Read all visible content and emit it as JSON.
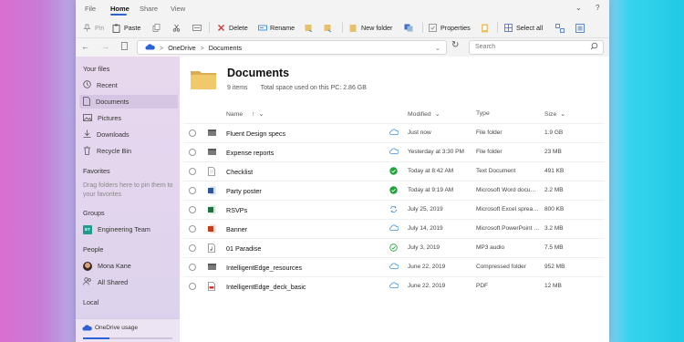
{
  "tabs": [
    "File",
    "Home",
    "Share",
    "View"
  ],
  "commands": {
    "pin": "Pin",
    "paste": "Paste",
    "delete": "Delete",
    "rename": "Rename",
    "new_folder": "New folder",
    "properties": "Properties",
    "select_all": "Select all"
  },
  "address": {
    "root": "OneDrive",
    "folder": "Documents",
    "search_placeholder": "Search"
  },
  "sidebar": {
    "your_files": "Your files",
    "items": [
      "Recent",
      "Documents",
      "Pictures",
      "Downloads",
      "Recycle Bin"
    ],
    "favorites": "Favorites",
    "favorites_note": "Drag folders here to pin them to your favorites",
    "groups": "Groups",
    "group_badge": "ET",
    "group_item": "Engineering Team",
    "people": "People",
    "people_items": [
      "Mona Kane",
      "All Shared"
    ],
    "local": "Local",
    "onedrive_usage": "OneDrive usage",
    "usage_fraction": 0.3
  },
  "content": {
    "title": "Documents",
    "item_count": "9 items",
    "space_used": "Total space used on this PC: 2.86 GB",
    "columns": {
      "name": "Name",
      "modified": "Modified",
      "type": "Type",
      "size": "Size"
    },
    "files": [
      {
        "name": "Fluent Design specs",
        "status": "cloud",
        "modified": "Just now",
        "type": "File folder",
        "size": "1.9 GB",
        "icon": "folder-icon"
      },
      {
        "name": "Expense reports",
        "status": "cloud",
        "modified": "Yesterday at 3:30 PM",
        "type": "File folder",
        "size": "23 MB",
        "icon": "folder-icon"
      },
      {
        "name": "Checklist",
        "status": "synced",
        "modified": "Today at 8:42 AM",
        "type": "Text Document",
        "size": "491 KB",
        "icon": "text-file-icon"
      },
      {
        "name": "Party poster",
        "status": "synced",
        "modified": "Today at 9:19 AM",
        "type": "Microsoft Word docum...",
        "size": "2.2 MB",
        "icon": "word-file-icon"
      },
      {
        "name": "RSVPs",
        "status": "syncing",
        "modified": "July 25, 2019",
        "type": "Microsoft Excel spreads...",
        "size": "800 KB",
        "icon": "excel-file-icon"
      },
      {
        "name": "Banner",
        "status": "cloud",
        "modified": "July 14, 2019",
        "type": "Microsoft PowerPoint p...",
        "size": "3.2 MB",
        "icon": "powerpoint-file-icon"
      },
      {
        "name": "01 Paradise",
        "status": "available",
        "modified": "July 3, 2019",
        "type": "MP3 audio",
        "size": "7.5 MB",
        "icon": "audio-file-icon"
      },
      {
        "name": "IntelligentEdge_resources",
        "status": "cloud",
        "modified": "June 22, 2019",
        "type": "Compressed folder",
        "size": "952 MB",
        "icon": "zip-file-icon"
      },
      {
        "name": "IntelligentEdge_deck_basic",
        "status": "cloud",
        "modified": "June 22, 2019",
        "type": "PDF",
        "size": "12 MB",
        "icon": "pdf-file-icon"
      }
    ]
  },
  "colors": {
    "accent": "#2b62d6",
    "delete": "#d13438",
    "synced": "#20a33a",
    "cloud": "#3b8fd9",
    "folder": "#e8c068"
  }
}
